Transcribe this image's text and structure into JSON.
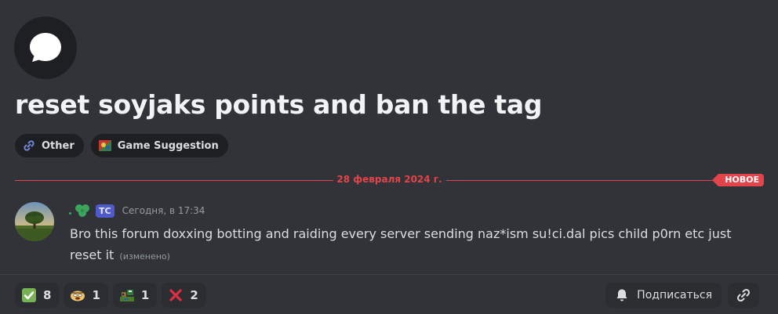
{
  "thread": {
    "title": "reset soyjaks points and ban the tag",
    "tags": [
      {
        "label": "Other",
        "icon": "link-icon"
      },
      {
        "label": "Game Suggestion",
        "icon": "flag-icon"
      }
    ]
  },
  "divider": {
    "date": "28 февраля 2024 г.",
    "new_label": "НОВОЕ",
    "color": "#e3444a"
  },
  "message": {
    "badge": "TC",
    "timestamp": "Сегодня, в 17:34",
    "text": "Bro this forum doxxing botting and raiding every server sending naz*ism su!ci.dal pics child p0rn etc just reset it",
    "edited": "(изменено)"
  },
  "reactions": [
    {
      "emoji": "check-mark-emoji",
      "count": "8"
    },
    {
      "emoji": "soyjak-emoji",
      "count": "1"
    },
    {
      "emoji": "pixel-emoji",
      "count": "1"
    },
    {
      "emoji": "cross-mark-emoji",
      "count": "2"
    }
  ],
  "actions": {
    "follow_label": "Подписаться",
    "link_icon": "link-icon"
  }
}
